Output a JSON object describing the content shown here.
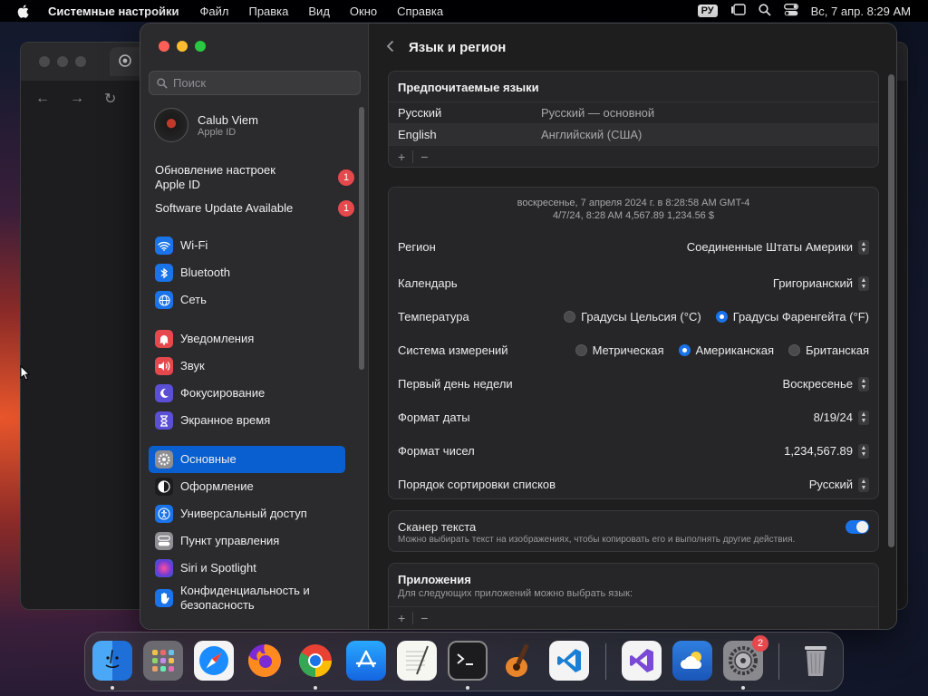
{
  "menubar": {
    "app": "Системные настройки",
    "items": [
      "Файл",
      "Правка",
      "Вид",
      "Окно",
      "Справка"
    ],
    "input_source": "РУ",
    "clock": "Вс, 7 апр. 8:29 AM"
  },
  "sidebar": {
    "search_placeholder": "Поиск",
    "profile_name": "Calub Viem",
    "profile_sub": "Apple ID",
    "notices": [
      {
        "label": "Обновление настроек Apple ID",
        "count": "1"
      },
      {
        "label": "Software Update Available",
        "count": "1"
      }
    ],
    "items": [
      {
        "label": "Wi-Fi",
        "icon": "wifi-icon",
        "color": "#1a73e8"
      },
      {
        "label": "Bluetooth",
        "icon": "bluetooth-icon",
        "color": "#1a73e8"
      },
      {
        "label": "Сеть",
        "icon": "globe-icon",
        "color": "#1a73e8"
      },
      {
        "label": "Уведомления",
        "icon": "bell-icon",
        "color": "#e5484d"
      },
      {
        "label": "Звук",
        "icon": "speaker-icon",
        "color": "#e5484d"
      },
      {
        "label": "Фокусирование",
        "icon": "moon-icon",
        "color": "#5b4fd6"
      },
      {
        "label": "Экранное время",
        "icon": "hourglass-icon",
        "color": "#5b4fd6"
      },
      {
        "label": "Основные",
        "icon": "gear-icon",
        "color": "#8e8e93"
      },
      {
        "label": "Оформление",
        "icon": "appearance-icon",
        "color": "#1c1c1e"
      },
      {
        "label": "Универсальный доступ",
        "icon": "accessibility-icon",
        "color": "#1a73e8"
      },
      {
        "label": "Пункт управления",
        "icon": "control-center-icon",
        "color": "#8e8e93"
      },
      {
        "label": "Siri и Spotlight",
        "icon": "siri-icon",
        "color": "#8a3ab9"
      },
      {
        "label": "Конфиденциальность и безопасность",
        "icon": "hand-icon",
        "color": "#1a73e8"
      }
    ]
  },
  "content": {
    "title": "Язык и регион",
    "preferred": {
      "heading": "Предпочитаемые языки",
      "languages": [
        {
          "name": "Русский",
          "detail": "Русский — основной"
        },
        {
          "name": "English",
          "detail": "Английский (США)"
        }
      ],
      "add": "+",
      "remove": "−"
    },
    "sample_line1": "воскресенье, 7 апреля 2024 г. в 8:28:58 AM GMT-4",
    "sample_line2": "4/7/24, 8:28 AM      4,567.89      1,234.56 $",
    "region": {
      "label": "Регион",
      "value": "Соединенные Штаты Америки"
    },
    "calendar": {
      "label": "Календарь",
      "value": "Григорианский"
    },
    "temperature": {
      "label": "Температура",
      "opt1": "Градусы Цельсия (°C)",
      "opt2": "Градусы Фаренгейта (°F)"
    },
    "measure": {
      "label": "Система измерений",
      "opt1": "Метрическая",
      "opt2": "Американская",
      "opt3": "Британская"
    },
    "first_day": {
      "label": "Первый день недели",
      "value": "Воскресенье"
    },
    "date_format": {
      "label": "Формат даты",
      "value": "8/19/24"
    },
    "number_format": {
      "label": "Формат чисел",
      "value": "1,234,567.89"
    },
    "sort_order": {
      "label": "Порядок сортировки списков",
      "value": "Русский"
    },
    "live_text": {
      "label": "Сканер текста",
      "desc": "Можно выбирать текст на изображениях, чтобы копировать его и выполнять другие действия."
    },
    "apps": {
      "heading": "Приложения",
      "desc": "Для следующих приложений можно выбрать язык:",
      "add": "+",
      "remove": "−"
    }
  },
  "dock": {
    "settings_badge": "2"
  }
}
